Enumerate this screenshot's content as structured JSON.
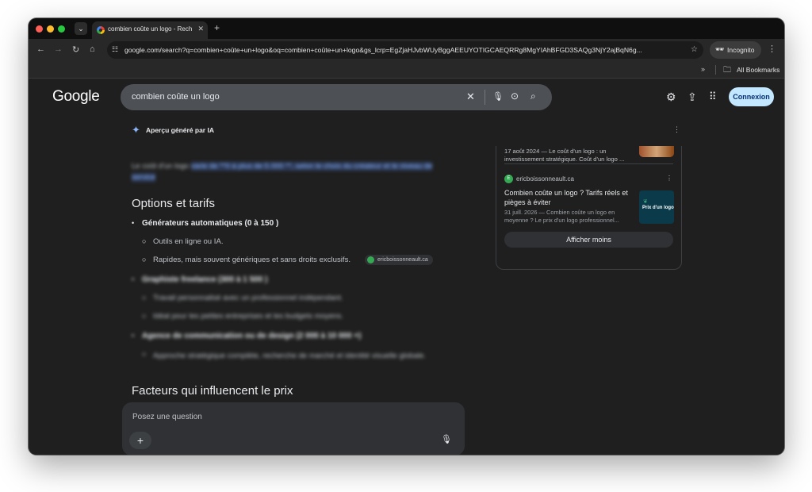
{
  "browser": {
    "tab_title": "combien coûte un logo - Rech",
    "url": "google.com/search?q=combien+coûte+un+logo&oq=combien+coûte+un+logo&gs_lcrp=EgZjaHJvbWUyBggAEEUYOTIGCAEQRRg8MgYIAhBFGD3SAQg3NjY2ajBqN6g...",
    "incognito_label": "Incognito",
    "bookmarks_label": "All Bookmarks"
  },
  "header": {
    "logo": "Google",
    "query": "combien coûte un logo",
    "signin_label": "Connexion"
  },
  "ai_overview": {
    "title": "Aperçu généré par IA",
    "blurred_intro_a": "Le coût d'un logo ",
    "blurred_intro_b": "varie de **0 à plus de 5 000 **, selon le choix du créateur et le niveau de service",
    "section_title": "Options et tarifs",
    "items": [
      {
        "title": "Générateurs automatiques (0 à 150 )",
        "subs": [
          "Outils en ligne ou IA.",
          "Rapides, mais souvent génériques et sans droits exclusifs."
        ],
        "source": "ericboissonneault.ca"
      },
      {
        "title": "Graphiste freelance (300 à 1 500 )",
        "subs": [
          "Travail personnalisé avec un professionnel indépendant.",
          "Idéal pour les petites entreprises et les budgets moyens."
        ]
      },
      {
        "title": "Agence de communication ou de design (2 000 à 10 000 +)",
        "subs": [
          "Approche stratégique complète, recherche de marché et identité visuelle globale."
        ]
      }
    ],
    "section2_title": "Facteurs qui influencent le prix"
  },
  "side_card": {
    "top_snippet": "17 août 2024 — Le coût d'un logo : un investissement stratégique. Coût d'un logo ...",
    "site": "ericboissonneault.ca",
    "site_initial": "E",
    "title": "Combien coûte un logo ? Tarifs réels et pièges à éviter",
    "snippet": "31 juill. 2026 — Combien coûte un logo en moyenne ? Le prix d'un logo professionnel...",
    "thumb_text": "Prix d'un logo",
    "show_less": "Afficher moins"
  },
  "ask": {
    "placeholder": "Posez une question"
  }
}
